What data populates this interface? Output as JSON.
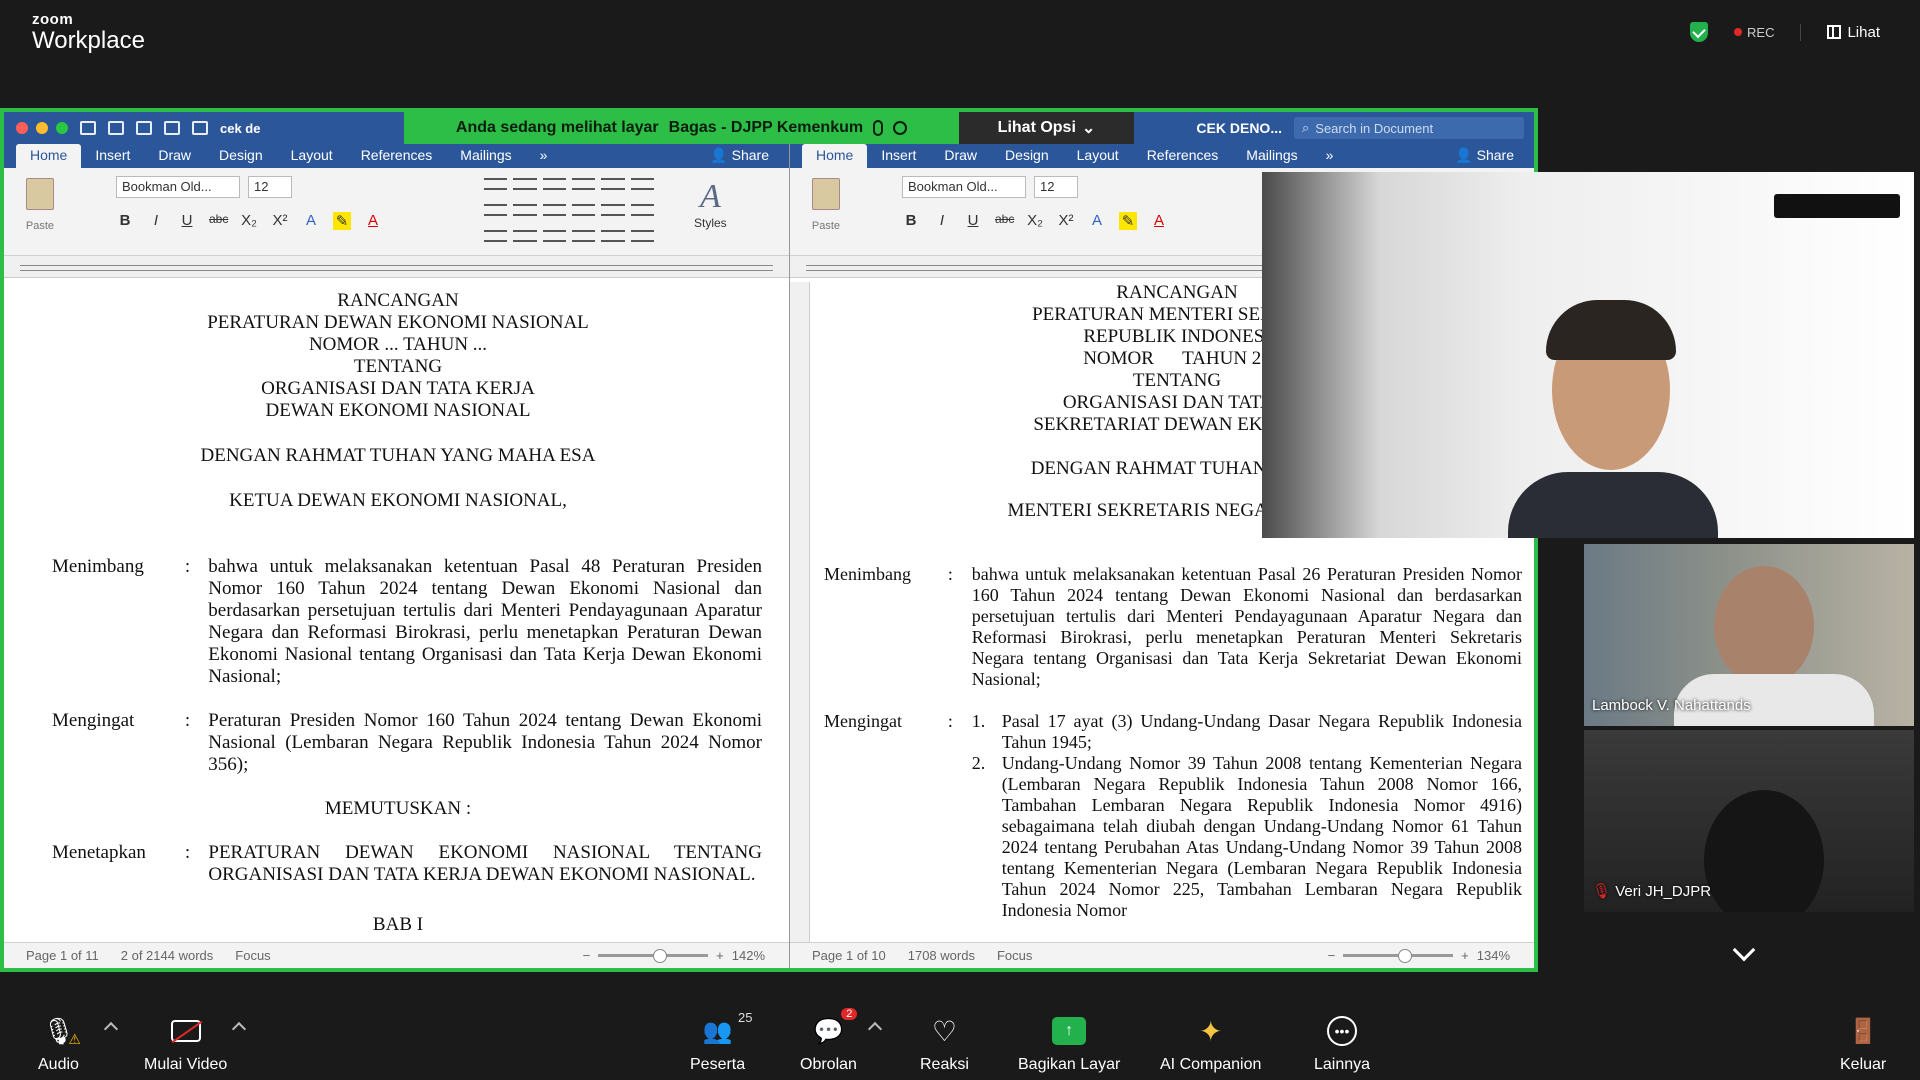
{
  "app": {
    "brand_top": "zoom",
    "brand_bottom": "Workplace",
    "rec": "REC",
    "view_button": "Lihat"
  },
  "share": {
    "banner_text": "Anda sedang melihat layar",
    "presenter": "Bagas - DJPP Kemenkum",
    "options": "Lihat Opsi"
  },
  "left_doc": {
    "doc_name": "cek de",
    "tabs": [
      "Home",
      "Insert",
      "Draw",
      "Design",
      "Layout",
      "References",
      "Mailings"
    ],
    "more": "»",
    "share": "Share",
    "font": "Bookman Old...",
    "size": "12",
    "paste": "Paste",
    "styles": "Styles",
    "header": [
      "RANCANGAN",
      "PERATURAN DEWAN EKONOMI NASIONAL",
      "NOMOR ... TAHUN ...",
      "TENTANG",
      "ORGANISASI DAN TATA KERJA",
      "DEWAN EKONOMI NASIONAL"
    ],
    "rahmat": "DENGAN RAHMAT TUHAN YANG MAHA ESA",
    "ketua": "KETUA DEWAN EKONOMI NASIONAL,",
    "menimbang_label": "Menimbang",
    "menimbang_text": "bahwa untuk melaksanakan ketentuan Pasal 48 Peraturan Presiden Nomor 160 Tahun 2024 tentang Dewan Ekonomi Nasional dan berdasarkan persetujuan tertulis dari Menteri Pendayagunaan Aparatur Negara dan Reformasi Birokrasi, perlu menetapkan Peraturan Dewan Ekonomi Nasional tentang Organisasi dan Tata Kerja Dewan Ekonomi Nasional;",
    "mengingat_label": "Mengingat",
    "mengingat_text": "Peraturan Presiden Nomor 160 Tahun 2024 tentang Dewan Ekonomi Nasional (Lembaran Negara Republik Indonesia Tahun 2024 Nomor 356);",
    "memutuskan": "MEMUTUSKAN :",
    "menetapkan_label": "Menetapkan",
    "menetapkan_text": "PERATURAN DEWAN EKONOMI NASIONAL TENTANG ORGANISASI DAN TATA KERJA DEWAN EKONOMI NASIONAL.",
    "bab": "BAB I",
    "colon": ":",
    "status_page": "Page 1 of 11",
    "status_words": "2 of 2144 words",
    "focus": "Focus",
    "zoom": "142%"
  },
  "right_doc": {
    "title": "CEK DENO...",
    "search_placeholder": "Search in Document",
    "tabs": [
      "Home",
      "Insert",
      "Draw",
      "Design",
      "Layout",
      "References",
      "Mailings"
    ],
    "more": "»",
    "share": "Share",
    "font": "Bookman Old...",
    "size": "12",
    "paste": "Paste",
    "header": [
      "RANCANGAN",
      "PERATURAN MENTERI SEKRETA",
      "REPUBLIK INDONESI",
      "NOMOR      TAHUN 20",
      "TENTANG",
      "ORGANISASI DAN TATA K",
      "SEKRETARIAT DEWAN EKONOM"
    ],
    "rahmat": "DENGAN RAHMAT TUHAN YANG",
    "menteri": "MENTERI SEKRETARIS NEGARA REPU",
    "menimbang_label": "Menimbang",
    "menimbang_text": "bahwa untuk melaksanakan ketentuan Pasal 26 Peraturan Presiden Nomor 160 Tahun 2024 tentang Dewan Ekonomi Nasional dan berdasarkan persetujuan tertulis dari Menteri Pendayagunaan Aparatur Negara dan Reformasi Birokrasi, perlu menetapkan Peraturan Menteri Sekretaris Negara tentang Organisasi dan Tata Kerja Sekretariat Dewan Ekonomi Nasional;",
    "mengingat_label": "Mengingat",
    "items": [
      {
        "num": "1.",
        "text": "Pasal 17 ayat (3) Undang-Undang Dasar Negara Republik Indonesia Tahun 1945;"
      },
      {
        "num": "2.",
        "text": "Undang-Undang Nomor 39 Tahun 2008 tentang Kementerian Negara (Lembaran Negara Republik Indonesia Tahun 2008 Nomor 166, Tambahan Lembaran Negara Republik Indonesia Nomor 4916) sebagaimana telah diubah dengan Undang-Undang Nomor 61 Tahun 2024 tentang Perubahan Atas Undang-Undang Nomor 39 Tahun 2008 tentang Kementerian Negara (Lembaran Negara Republik Indonesia Tahun 2024 Nomor 225, Tambahan Lembaran Negara Republik Indonesia Nomor"
      }
    ],
    "colon": ":",
    "status_page": "Page 1 of 10",
    "status_words": "1708 words",
    "focus": "Focus",
    "zoom": "134%"
  },
  "participants": [
    {
      "name": "Lambock V. Nahattands"
    },
    {
      "name": "Veri JH_DJPR"
    }
  ],
  "toolbar": [
    {
      "label": "Audio",
      "icon": "mic-muted-icon"
    },
    {
      "label": "Mulai Video",
      "icon": "video-off-icon"
    },
    {
      "label": "Peserta",
      "icon": "participants-icon",
      "count": "25"
    },
    {
      "label": "Obrolan",
      "icon": "chat-icon",
      "badge": "2"
    },
    {
      "label": "Reaksi",
      "icon": "heart-icon"
    },
    {
      "label": "Bagikan Layar",
      "icon": "share-screen-icon"
    },
    {
      "label": "AI Companion",
      "icon": "sparkle-icon"
    },
    {
      "label": "Lainnya",
      "icon": "more-icon"
    },
    {
      "label": "Keluar",
      "icon": "leave-icon"
    }
  ]
}
